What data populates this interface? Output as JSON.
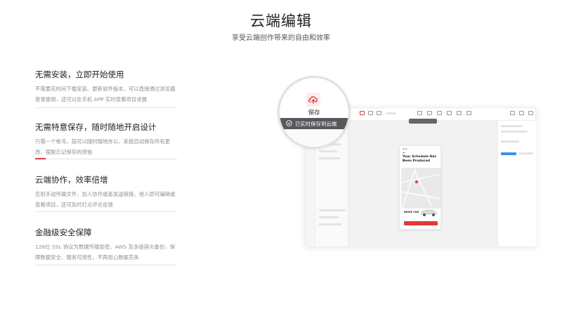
{
  "hero": {
    "title": "云端编辑",
    "subtitle": "享受云端创作带来的自由和效率"
  },
  "features": [
    {
      "title": "无需安装，立即开始使用",
      "desc": "不需要花时间下载安装、更新软件版本，可以直接通过浏览器登录使用，还可以在手机 APP 实时查看项目进展",
      "active": false
    },
    {
      "title": "无需特意保存，随时随地开启设计",
      "desc": "只需一个帐号，就可以随时随地办公，系统自动保存所有更改，摆脱忘记保存的烦恼",
      "active": true
    },
    {
      "title": "云端协作，效率倍增",
      "desc": "告别手动传输文件，加入协作或者发送链接，他人即可编辑或查看项目，还可及时打点评论反馈",
      "active": false
    },
    {
      "title": "金融级安全保障",
      "desc": "128位 SSL 协议为数据传输加密，AWS 及多级容灾备份，保障数据安全、服务可用性，不再担心数据丢失",
      "active": false
    }
  ],
  "preview": {
    "save_label": "保存",
    "autosave_banner": "已实时保存到云端",
    "phone_title": "Your Schedule Has Been Produced",
    "phone_time": "9:41",
    "phone_car_label": "DRIVE CAR",
    "icons": [
      "cloud-upload-icon",
      "check-circle-icon",
      "back-arrow-icon",
      "car-icon",
      "map-pin-icon"
    ],
    "accent_color": "#e0393a",
    "banner_color": "#56585b"
  }
}
